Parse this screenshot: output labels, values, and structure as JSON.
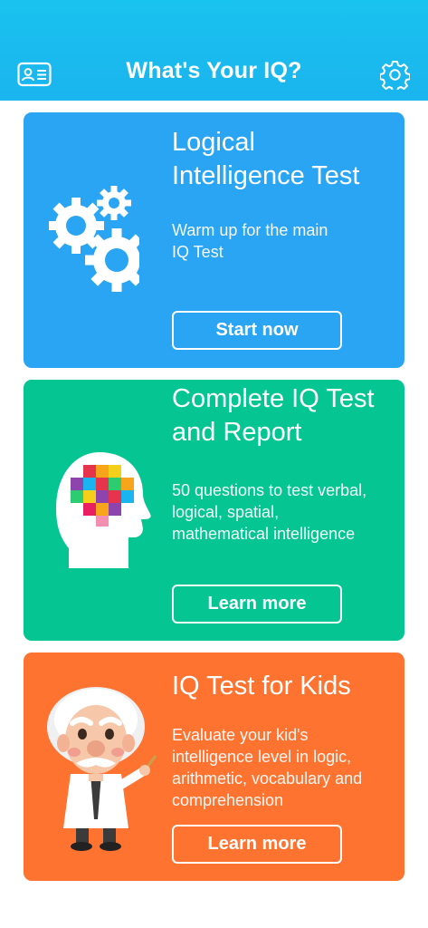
{
  "header": {
    "title": "What's Your IQ?",
    "background": "#19c3ef",
    "left_icon": "profile-card-icon",
    "right_icon": "gear-icon"
  },
  "cards": [
    {
      "title": "Logical\nIntelligence Test",
      "description": "Warm up for the main\nIQ Test",
      "button_label": "Start now",
      "color": "#2aa5f4",
      "icon": "gears-icon"
    },
    {
      "title": "Complete IQ Test\nand Report",
      "description": "50 questions to test verbal,\nlogical, spatial,\nmathematical intelligence",
      "button_label": "Learn more",
      "color": "#05c592",
      "icon": "head-brain-icon"
    },
    {
      "title": "IQ Test for Kids",
      "description": "Evaluate your kid's\nintelligence level in logic,\narithmetic, vocabulary and\ncomprehension",
      "button_label": "Learn more",
      "color": "#ff7331",
      "icon": "einstein-cartoon-icon"
    }
  ]
}
